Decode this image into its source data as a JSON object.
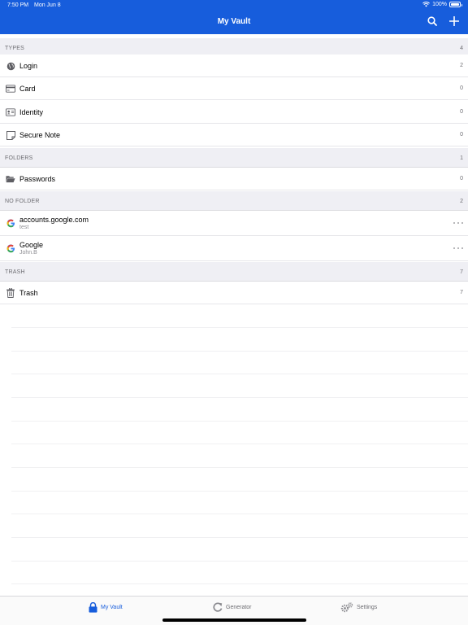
{
  "status_bar": {
    "time": "7:50 PM",
    "date": "Mon Jun 8",
    "battery": "100%"
  },
  "header": {
    "title": "My Vault",
    "search_icon": "search-icon",
    "add_icon": "plus-icon"
  },
  "sections": {
    "types": {
      "label": "TYPES",
      "count": "4",
      "items": [
        {
          "label": "Login",
          "count": "2",
          "icon": "globe-icon"
        },
        {
          "label": "Card",
          "count": "0",
          "icon": "credit-card-icon"
        },
        {
          "label": "Identity",
          "count": "0",
          "icon": "id-card-icon"
        },
        {
          "label": "Secure Note",
          "count": "0",
          "icon": "note-icon"
        }
      ]
    },
    "folders": {
      "label": "FOLDERS",
      "count": "1",
      "items": [
        {
          "label": "Passwords",
          "count": "0",
          "icon": "folder-open-icon"
        }
      ]
    },
    "no_folder": {
      "label": "NO FOLDER",
      "count": "2",
      "items": [
        {
          "label": "accounts.google.com",
          "sub": "test",
          "icon": "google-icon"
        },
        {
          "label": "Google",
          "sub": "John.B",
          "icon": "google-icon"
        }
      ]
    },
    "trash": {
      "label": "TRASH",
      "count": "7",
      "items": [
        {
          "label": "Trash",
          "count": "7",
          "icon": "trash-icon"
        }
      ]
    }
  },
  "tabbar": {
    "tabs": [
      {
        "label": "My Vault",
        "icon": "lock-icon",
        "active": true
      },
      {
        "label": "Generator",
        "icon": "refresh-icon",
        "active": false
      },
      {
        "label": "Settings",
        "icon": "gears-icon",
        "active": false
      }
    ]
  },
  "colors": {
    "brand": "#175ddc",
    "section_bg": "#efeff4",
    "muted": "#8e8e93"
  }
}
